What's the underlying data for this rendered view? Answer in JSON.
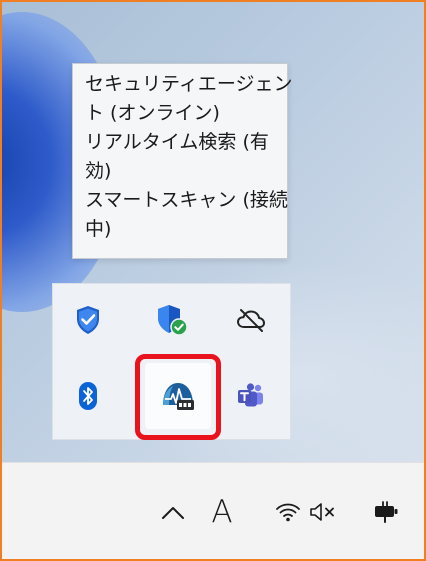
{
  "tooltip": {
    "lines": [
      "セキュリティエージェン",
      "ト (オンライン)",
      "リアルタイム検索 (有",
      "効)",
      "スマートスキャン (接続",
      "中)"
    ]
  },
  "tray_icons": [
    {
      "name": "windows-security-shield-icon",
      "row": 0,
      "col": 0
    },
    {
      "name": "security-agent-shield-check-icon",
      "row": 0,
      "col": 1
    },
    {
      "name": "cloud-offline-icon",
      "row": 0,
      "col": 2
    },
    {
      "name": "bluetooth-icon",
      "row": 1,
      "col": 0
    },
    {
      "name": "trend-agent-monitor-icon",
      "row": 1,
      "col": 1
    },
    {
      "name": "teams-icon",
      "row": 1,
      "col": 2
    }
  ],
  "taskbar": {
    "ime_mode": "A"
  },
  "colors": {
    "frame": "#f07f24",
    "highlight": "#e8131c",
    "shield_blue": "#1f6fe0",
    "check_green": "#2aa14a",
    "bluetooth": "#0b63d6",
    "teams": "#4b53bc"
  }
}
